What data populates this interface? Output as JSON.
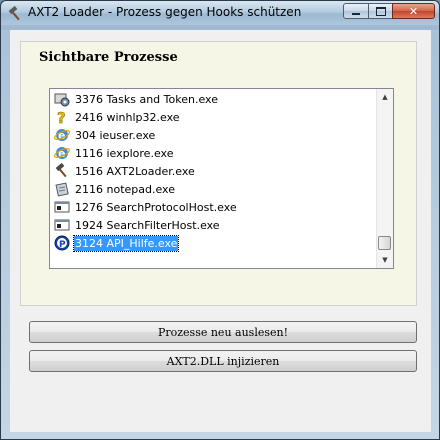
{
  "window": {
    "title": "AXT2 Loader - Prozess gegen Hooks schützen",
    "icon": "hammer-icon",
    "controls": {
      "minimize": "minimize-icon",
      "maximize": "maximize-icon",
      "close": "close-icon"
    }
  },
  "group": {
    "title": "Sichtbare Prozesse"
  },
  "processes": [
    {
      "label": "3376 Tasks and Token.exe",
      "icon": "app-gear-icon"
    },
    {
      "label": "2416 winhlp32.exe",
      "icon": "help-question-icon"
    },
    {
      "label": "304 ieuser.exe",
      "icon": "internet-explorer-icon"
    },
    {
      "label": "1116 iexplore.exe",
      "icon": "internet-explorer-icon"
    },
    {
      "label": "1516 AXT2Loader.exe",
      "icon": "hammer-icon"
    },
    {
      "label": "2116 notepad.exe",
      "icon": "notepad-icon"
    },
    {
      "label": "1276 SearchProtocolHost.exe",
      "icon": "console-window-icon"
    },
    {
      "label": "1924 SearchFilterHost.exe",
      "icon": "console-window-icon"
    },
    {
      "label": "3124 API_Hilfe.exe",
      "icon": "blue-p-icon",
      "selected": true
    }
  ],
  "buttons": {
    "reload": "Prozesse neu auslesen!",
    "inject": "AXT2.DLL injizieren"
  },
  "colors": {
    "selection": "#3399ff",
    "group_background": "#f6f6e6"
  }
}
